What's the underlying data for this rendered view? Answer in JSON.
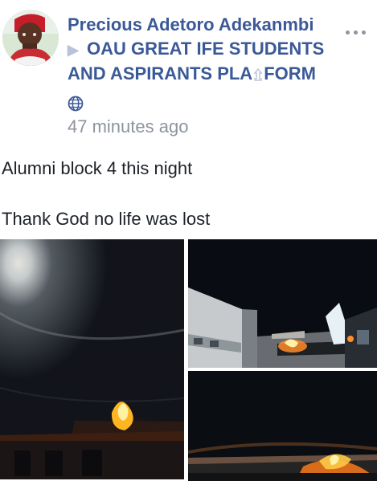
{
  "post": {
    "author": "Precious Adetoro Adekanmbi",
    "arrow_glyph": "▶",
    "group_line_1": "OAU GREAT IFE STUDENTS",
    "group_line_2_start": "AND ASPIRANTS PLA",
    "group_line_2_end": "FORM",
    "timestamp": "47 minutes ago",
    "message_line_1": "Alumni block 4 this night",
    "message_line_2": "Thank God no life was lost",
    "privacy_icon": "globe-icon",
    "menu_icon": "more-options-icon"
  },
  "photos": [
    {
      "icon": "fire-night-photo-main"
    },
    {
      "icon": "fire-night-photo-building"
    },
    {
      "icon": "fire-night-photo-roof"
    }
  ],
  "colors": {
    "link": "#3b5998",
    "timestamp": "#8d949e",
    "body_text": "#1d2129"
  }
}
